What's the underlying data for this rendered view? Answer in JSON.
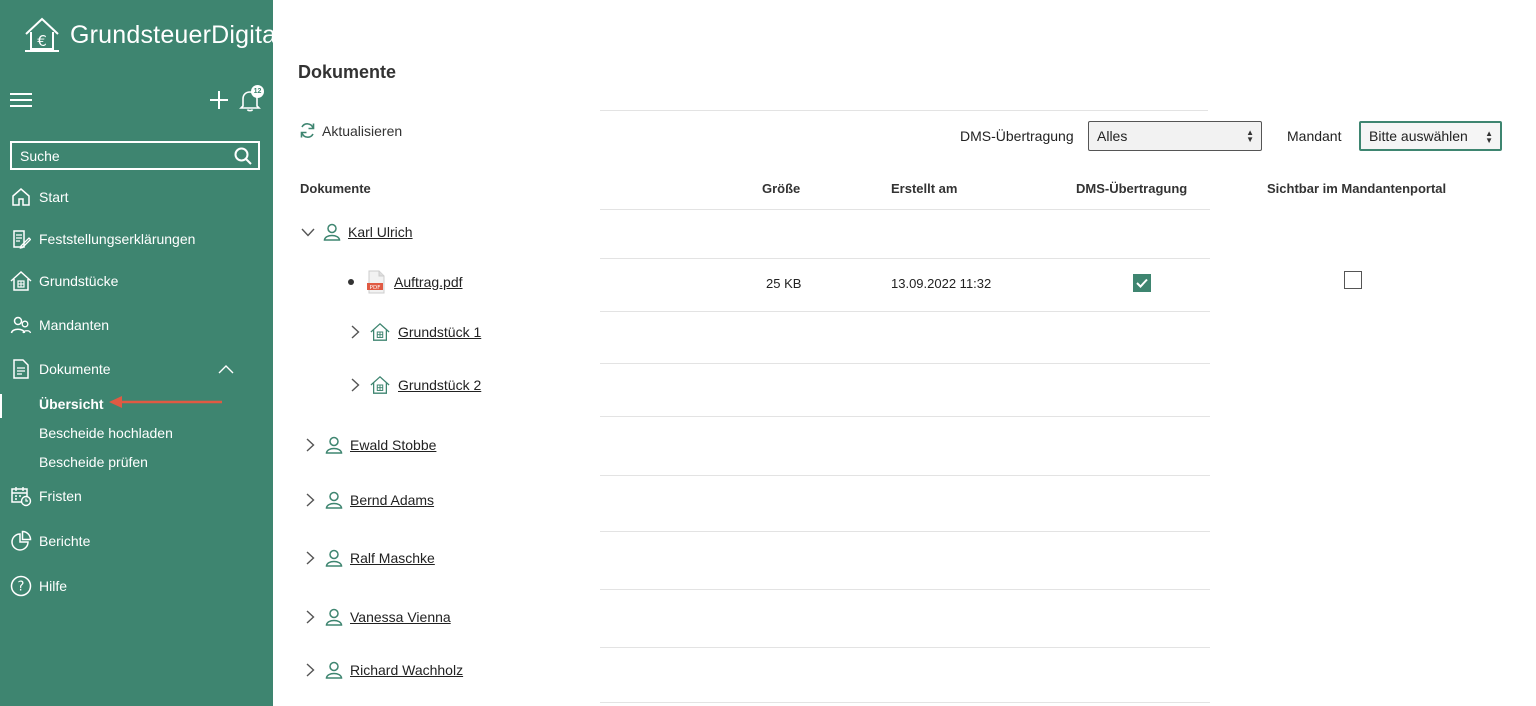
{
  "app": {
    "logo_text": "GrundsteuerDigital",
    "notification_count": "12",
    "search_placeholder": "Suche"
  },
  "sidebar": {
    "items": [
      {
        "label": "Start",
        "icon": "home-icon"
      },
      {
        "label": "Feststellungserklärungen",
        "icon": "document-edit-icon"
      },
      {
        "label": "Grundstücke",
        "icon": "building-icon"
      },
      {
        "label": "Mandanten",
        "icon": "users-icon"
      },
      {
        "label": "Dokumente",
        "icon": "document-icon"
      },
      {
        "label": "Fristen",
        "icon": "calendar-icon"
      },
      {
        "label": "Berichte",
        "icon": "pie-chart-icon"
      },
      {
        "label": "Hilfe",
        "icon": "help-icon"
      }
    ],
    "dokumente_sub": [
      "Übersicht",
      "Bescheide hochladen",
      "Bescheide prüfen"
    ]
  },
  "main": {
    "title": "Dokumente",
    "refresh_label": "Aktualisieren",
    "filters": {
      "dms_label": "DMS-Übertragung",
      "dms_value": "Alles",
      "mandant_label": "Mandant",
      "mandant_value": "Bitte auswählen"
    },
    "columns": [
      "Dokumente",
      "Größe",
      "Erstellt am",
      "DMS-Übertragung",
      "Sichtbar im Mandantenportal"
    ],
    "tree": {
      "expanded_client": "Karl Ulrich",
      "document": {
        "name": "Auftrag.pdf",
        "size": "25 KB",
        "created": "13.09.2022 11:32",
        "dms": true,
        "visible": false
      },
      "properties": [
        "Grundstück 1",
        "Grundstück 2"
      ],
      "clients": [
        "Ewald Stobbe",
        "Bernd Adams",
        "Ralf Maschke",
        "Vanessa Vienna",
        "Richard Wachholz"
      ]
    }
  },
  "colors": {
    "sidebar": "#3e8570",
    "accent": "#3e8570",
    "annotation_arrow": "#e05a43"
  }
}
